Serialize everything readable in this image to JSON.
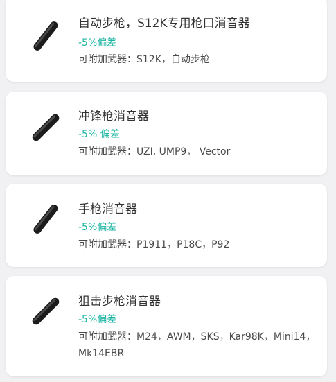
{
  "items": [
    {
      "title": "自动步枪，S12K专用枪口消音器",
      "deviation": "-5%偏差",
      "compat": "可附加武器：S12K，自动步枪",
      "icon": "suppressor-icon"
    },
    {
      "title": "冲锋枪消音器",
      "deviation": "-5% 偏差",
      "compat": "可附加武器：UZI, UMP9， Vector",
      "icon": "suppressor-icon"
    },
    {
      "title": "手枪消音器",
      "deviation": "-5%偏差",
      "compat": "可附加武器：P1911，P18C，P92",
      "icon": "suppressor-icon"
    },
    {
      "title": "狙击步枪消音器",
      "deviation": "-5%偏差",
      "compat": "可附加武器：M24，AWM，SKS，Kar98K，Mini14，Mk14EBR",
      "icon": "suppressor-icon"
    }
  ],
  "colors": {
    "background": "#f1f1f3",
    "card": "#ffffff",
    "accent": "#1cb5a3",
    "title": "#333333",
    "text": "#4a4a4a"
  }
}
